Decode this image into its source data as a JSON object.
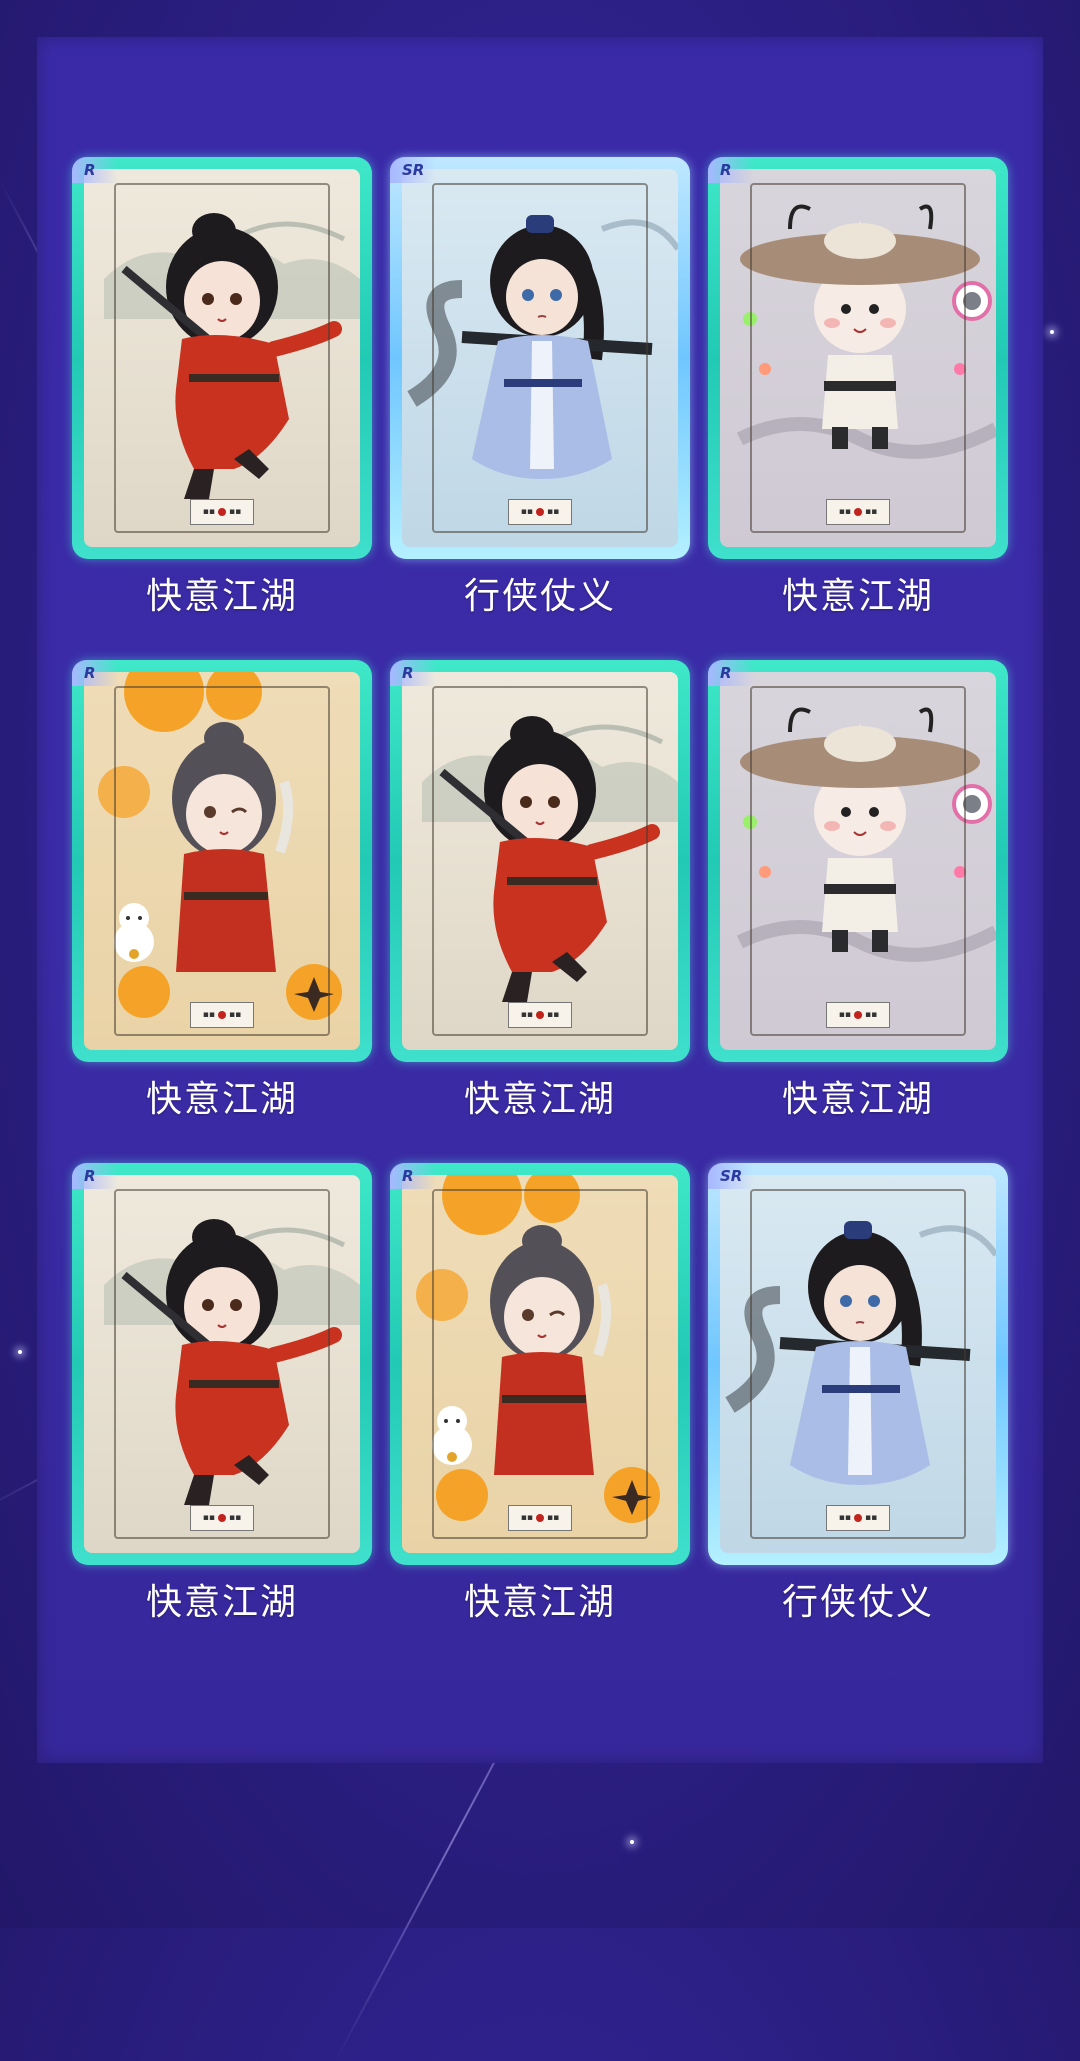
{
  "cards": [
    {
      "rarity": "R",
      "title": "快意江湖",
      "art": "red-swordsman",
      "bg": "plain"
    },
    {
      "rarity": "SR",
      "title": "行侠仗义",
      "art": "blue-swordsman",
      "bg": "sky"
    },
    {
      "rarity": "R",
      "title": "快意江湖",
      "art": "straw-hat-hero",
      "bg": "mist"
    },
    {
      "rarity": "R",
      "title": "快意江湖",
      "art": "lucky-cat-hero",
      "bg": "cat"
    },
    {
      "rarity": "R",
      "title": "快意江湖",
      "art": "red-swordsman",
      "bg": "plain"
    },
    {
      "rarity": "R",
      "title": "快意江湖",
      "art": "straw-hat-hero",
      "bg": "mist"
    },
    {
      "rarity": "R",
      "title": "快意江湖",
      "art": "red-swordsman",
      "bg": "plain"
    },
    {
      "rarity": "R",
      "title": "快意江湖",
      "art": "lucky-cat-hero",
      "bg": "cat"
    },
    {
      "rarity": "SR",
      "title": "行侠仗义",
      "art": "blue-swordsman",
      "bg": "sky"
    }
  ],
  "colors": {
    "background": "#2d2088",
    "panel": "#3a2aa8",
    "r_frame": "#22c9b4",
    "sr_frame": "#6fc6ff",
    "label": "#ffffff"
  }
}
